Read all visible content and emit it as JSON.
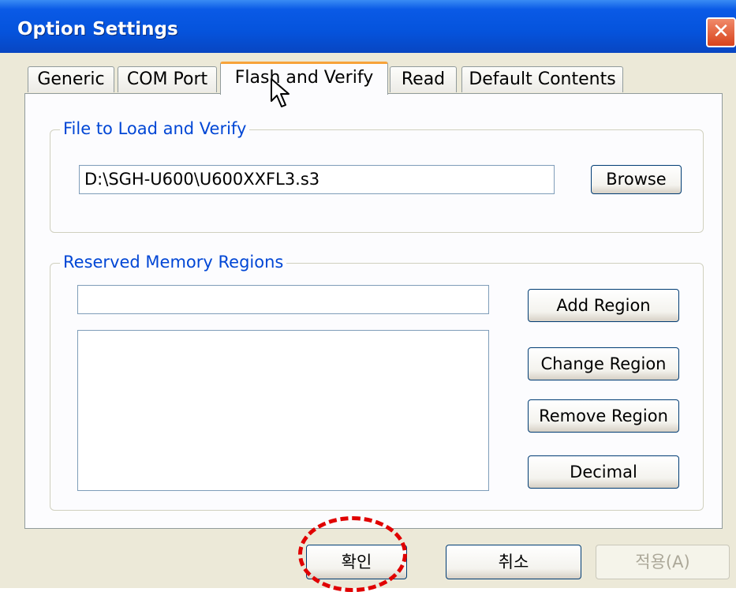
{
  "window": {
    "title": "Option Settings",
    "close_symbol": "✕"
  },
  "tabs": [
    {
      "label": "Generic"
    },
    {
      "label": "COM Port"
    },
    {
      "label": "Flash and Verify",
      "active": true
    },
    {
      "label": "Read"
    },
    {
      "label": "Default Contents"
    }
  ],
  "file_group": {
    "legend": "File to Load and Verify",
    "path_value": "D:\\SGH-U600\\U600XXFL3.s3",
    "browse_label": "Browse"
  },
  "memory_group": {
    "legend": "Reserved Memory Regions",
    "region_input_value": "",
    "buttons": {
      "add": "Add Region",
      "change": "Change Region",
      "remove": "Remove Region",
      "decimal": "Decimal"
    }
  },
  "footer": {
    "ok_label": "확인",
    "cancel_label": "취소",
    "apply_label": "적용(A)"
  },
  "colors": {
    "titlebar": "#0553dc",
    "legend_text": "#0046d5",
    "active_tab_accent": "#f7a33a",
    "highlight": "#e00000"
  },
  "icons": {
    "close": "close-icon",
    "cursor": "mouse-cursor-icon"
  }
}
